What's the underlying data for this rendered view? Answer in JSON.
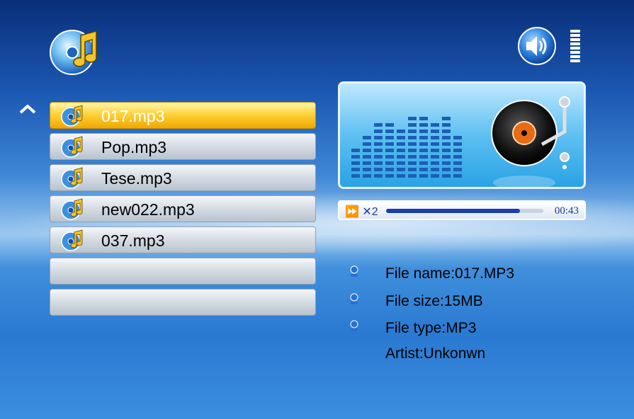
{
  "playlist": {
    "items": [
      {
        "label": "017.mp3",
        "selected": true
      },
      {
        "label": "Pop.mp3",
        "selected": false
      },
      {
        "label": "Tese.mp3",
        "selected": false
      },
      {
        "label": "new022.mp3",
        "selected": false
      },
      {
        "label": "037.mp3",
        "selected": false
      },
      {
        "label": "",
        "selected": false
      },
      {
        "label": "",
        "selected": false
      }
    ]
  },
  "player": {
    "speed_label": "⏩ ✕2",
    "time": "00:43",
    "progress": 0.85
  },
  "volume": {
    "level_bars": 8,
    "total_bars": 8
  },
  "file_info": {
    "name": "File name:017.MP3",
    "size": "File size:15MB",
    "type": "File type:MP3",
    "artist": "Artist:Unkonwn"
  },
  "icons": {
    "app": "music-note-disc-icon",
    "speaker": "speaker-icon",
    "scroll_up": "chevron-up-icon",
    "track": "music-disc-icon",
    "bullet": "info-bullet-icon"
  },
  "colors": {
    "selected_row": "#ffd23a",
    "row": "#d4dbe3",
    "progress_fill": "#1b3fb0"
  }
}
